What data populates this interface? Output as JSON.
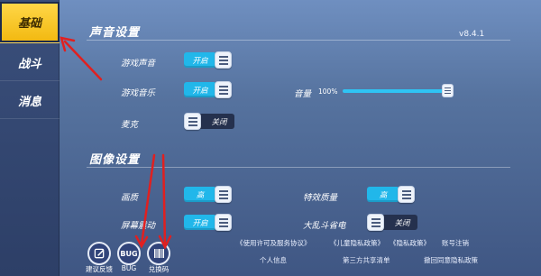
{
  "sidebar": {
    "items": [
      {
        "label": "基础",
        "active": true
      },
      {
        "label": "战斗",
        "active": false
      },
      {
        "label": "消息",
        "active": false
      }
    ]
  },
  "version": "v8.4.1",
  "sound": {
    "title": "声音设置",
    "game_sound": {
      "label": "游戏声音",
      "value": "开启"
    },
    "game_music": {
      "label": "游戏音乐",
      "value": "开启"
    },
    "microphone": {
      "label": "麦克",
      "value": "关闭"
    },
    "volume": {
      "label": "音量",
      "value_text": "100%",
      "level": 1.0
    }
  },
  "graphics": {
    "title": "图像设置",
    "quality": {
      "label": "画质",
      "value": "高"
    },
    "effects_quality": {
      "label": "特效质量",
      "value": "高"
    },
    "screen_shake": {
      "label": "屏幕震动",
      "value": "开启"
    },
    "power_saving": {
      "label": "大乱斗省电",
      "value": "关闭"
    }
  },
  "bottom": {
    "feedback": {
      "icon": "pencil-icon",
      "label": "建议反馈"
    },
    "bug": {
      "icon_text": "BUG",
      "label": "BUG"
    },
    "redeem": {
      "icon": "barcode-icon",
      "label": "兑换码"
    }
  },
  "links": {
    "license": "《使用许可及服务协议》",
    "child_privacy": "《儿童隐私政策》",
    "privacy": "《隐私政策》",
    "account_logout": "账号注销",
    "personal_info": "个人信息",
    "third_party": "第三方共享清单",
    "withdraw_privacy": "撤回同意隐私政策"
  },
  "colors": {
    "toggle_on": "#21b7ea",
    "toggle_off": "#25314e",
    "sidebar_active": "#f2b80f",
    "annotation_arrow": "#e02020"
  }
}
